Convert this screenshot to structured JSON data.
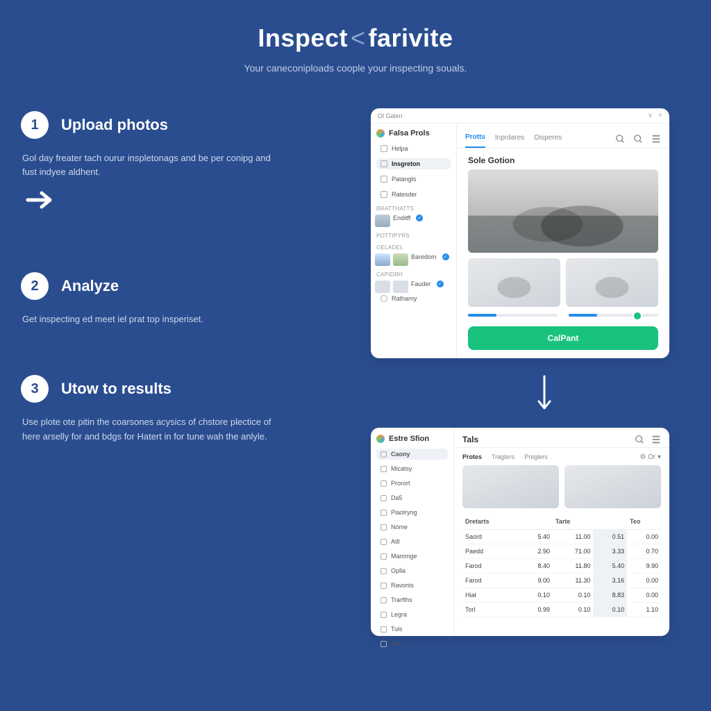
{
  "hero": {
    "title_a": "Inspect",
    "title_b": "farivite",
    "subtitle": "Your caneconiploads coople your inspecting souals."
  },
  "steps": [
    {
      "n": "1",
      "title": "Upload photos",
      "desc": "Gol day freater tach ourur inspletonags and be per conipg and fust indyee aldhent."
    },
    {
      "n": "2",
      "title": "Analyze",
      "desc": "Get inspecting ed meet iel prat top insperiset."
    },
    {
      "n": "3",
      "title": "Utow to results",
      "desc": "Use plote ote pitin the coarsones acysics of chstore plectice of here arselly for and bdgs for Hatert in for tune wah the anlyle."
    }
  ],
  "card1": {
    "window_title": "Ol Galen",
    "brand": "Falsa Prols",
    "nav": [
      {
        "label": "Helpa"
      },
      {
        "label": "Insgreton",
        "active": true
      },
      {
        "label": "Patangts"
      },
      {
        "label": "Ratesder"
      }
    ],
    "groups": [
      {
        "head": "Bratthatts",
        "labels": [
          "Enditff"
        ]
      },
      {
        "head": "Pottipyrs",
        "labels": []
      },
      {
        "head": "Geladel",
        "labels": [
          "Baredom"
        ]
      },
      {
        "head": "Capidrh",
        "labels": [
          "Fauder"
        ]
      }
    ],
    "footer_nav": "Ratharny",
    "tabs": [
      "Protts",
      "Inprdares",
      "Oisperes"
    ],
    "section_title": "Sole Gotion",
    "cta": "CalPant"
  },
  "card2": {
    "brand": "Estre Sfion",
    "title": "Tals",
    "nav": [
      "Caony",
      "Micatsy",
      "Prorort",
      "Da5",
      "Piaolryng",
      "Nóme",
      "Atll",
      "Mammge",
      "Oplla",
      "Ravonts",
      "Trarfths",
      "Legra",
      "Tuls",
      "Terl"
    ],
    "tabs": [
      "Protes",
      "Tragters",
      "Preglers"
    ],
    "setting": "Or",
    "table": {
      "headers": [
        "Dretarts",
        "",
        "Tarte",
        "",
        "Teo"
      ],
      "rows": [
        [
          "Saord",
          "5.40",
          "11.00",
          "0.51",
          "0.00"
        ],
        [
          "Paedd",
          "2.90",
          "71.00",
          "3.33",
          "0.70"
        ],
        [
          "Farod",
          "8.40",
          "11.80",
          "5.40",
          "9.90"
        ],
        [
          "Farod",
          "9.00",
          "11.30",
          "3.16",
          "0.00"
        ],
        [
          "Hiat",
          "0.10",
          "0.10",
          "8.83",
          "0.00"
        ],
        [
          "Torl",
          "0.99",
          "0.10",
          "0.10",
          "1.10"
        ]
      ]
    }
  }
}
